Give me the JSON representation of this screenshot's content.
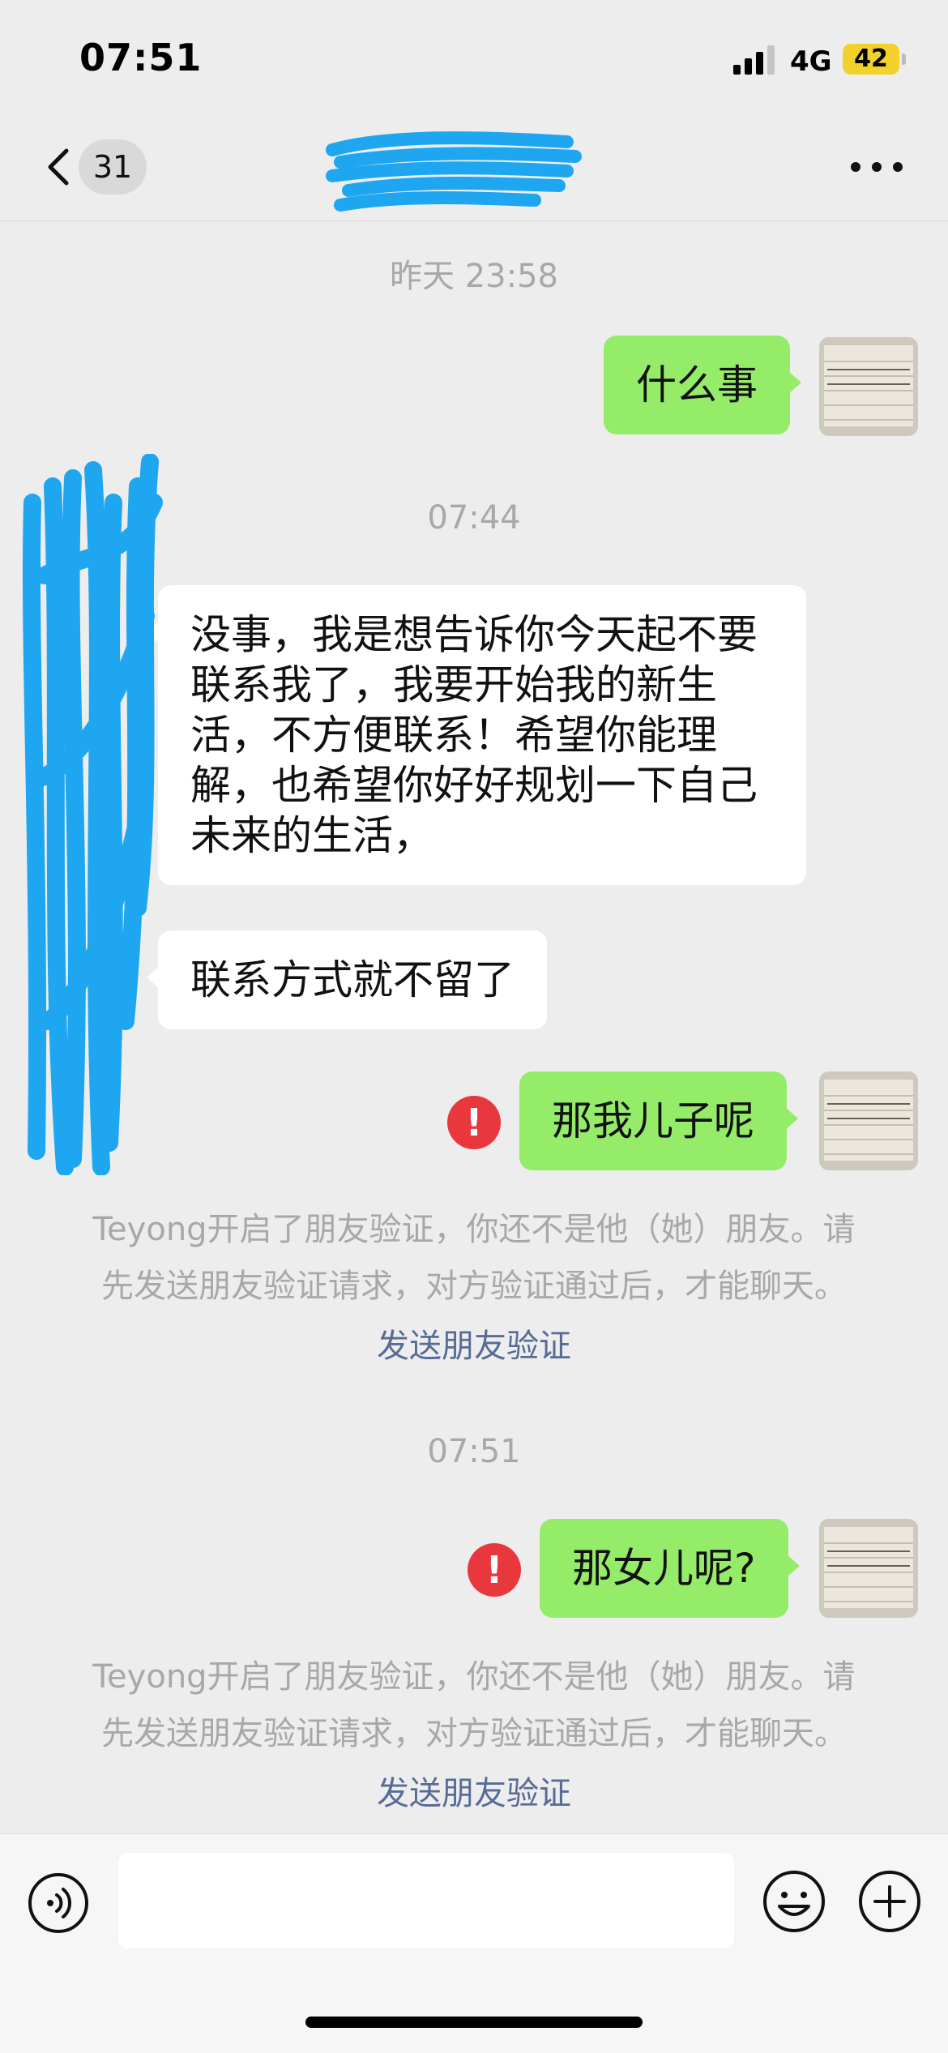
{
  "status_bar": {
    "time": "07:51",
    "network": "4G",
    "battery": "42"
  },
  "nav": {
    "unread_count": "31",
    "icons": [
      "back-icon",
      "more-icon"
    ]
  },
  "chat": {
    "ts1": "昨天 23:58",
    "msg1": "什么事",
    "ts2": "07:44",
    "msg2_lines": [
      "没事，我是想告诉你今天起不要",
      "联系我了，我要开始我的新生",
      "活，不方便联系！希望你能理",
      "解，也希望你好好规划一下自己",
      "未来的生活，"
    ],
    "msg3": "联系方式就不留了",
    "msg4": "那我儿子呢",
    "notice1_line1": "Teyong开启了朋友验证，你还不是他（她）朋友。请",
    "notice1_line2": "先发送朋友验证请求，对方验证通过后，才能聊天。",
    "notice1_link": "发送朋友验证",
    "ts3": "07:51",
    "msg5": "那女儿呢?",
    "notice2_line1": "Teyong开启了朋友验证，你还不是他（她）朋友。请",
    "notice2_line2": "先发送朋友验证请求，对方验证通过后，才能聊天。",
    "notice2_link": "发送朋友验证",
    "error_glyph": "!"
  },
  "input_bar": {
    "icons": [
      "voice-icon",
      "emoji-icon",
      "plus-icon"
    ]
  },
  "colors": {
    "outgoing_bubble": "#95ec69",
    "incoming_bubble": "#ffffff",
    "error": "#e8383d",
    "link": "#576b95",
    "redaction": "#1ea7f0",
    "battery": "#f2d12b"
  }
}
